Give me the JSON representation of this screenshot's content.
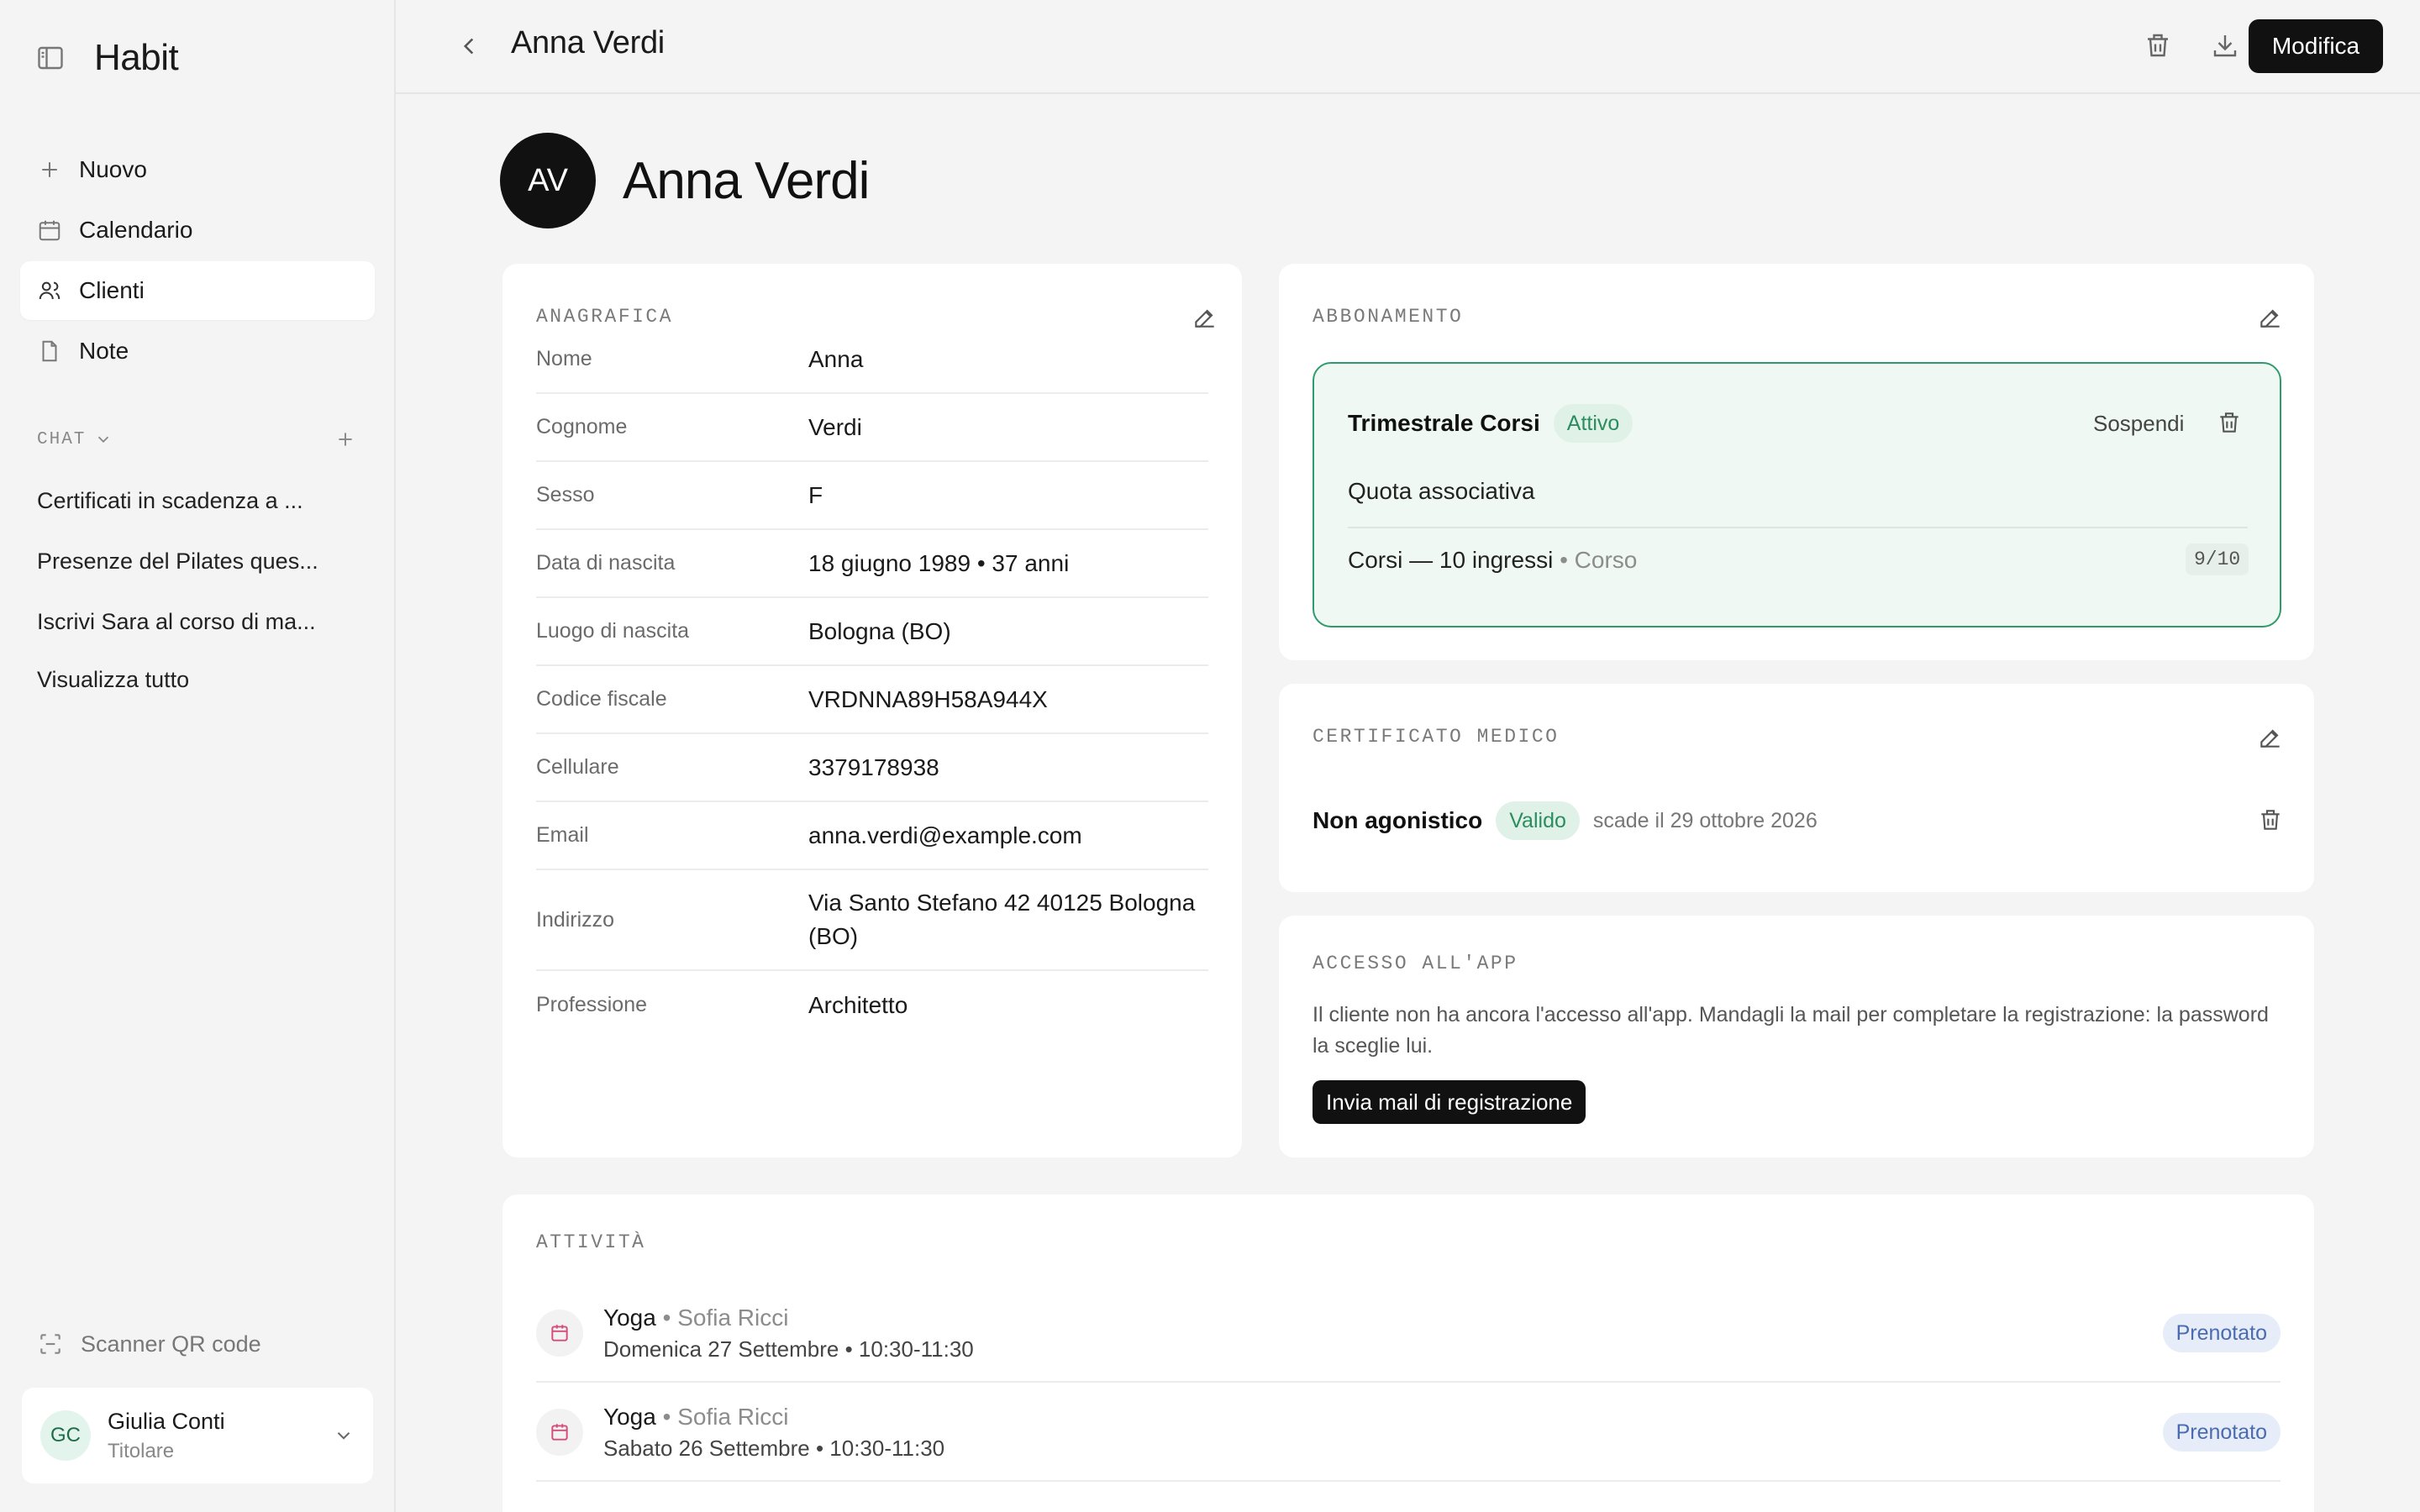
{
  "app": {
    "name": "Habit"
  },
  "sidebar": {
    "nav": [
      {
        "label": "Nuovo",
        "icon": "plus-icon"
      },
      {
        "label": "Calendario",
        "icon": "calendar-icon"
      },
      {
        "label": "Clienti",
        "icon": "users-icon",
        "active": true
      },
      {
        "label": "Note",
        "icon": "note-icon"
      }
    ],
    "chat_label": "CHAT",
    "chats": [
      "Certificati in scadenza a ...",
      "Presenze del Pilates ques...",
      "Iscrivi Sara al corso di ma...",
      "Visualizza tutto"
    ],
    "qr_label": "Scanner QR code",
    "user": {
      "initials": "GC",
      "name": "Giulia Conti",
      "role": "Titolare"
    }
  },
  "topbar": {
    "title": "Anna Verdi",
    "edit_label": "Modifica"
  },
  "profile": {
    "initials": "AV",
    "name": "Anna Verdi"
  },
  "anagrafica": {
    "title": "ANAGRAFICA",
    "rows": [
      {
        "key": "Nome",
        "value": "Anna"
      },
      {
        "key": "Cognome",
        "value": "Verdi"
      },
      {
        "key": "Sesso",
        "value": "F"
      },
      {
        "key": "Data di nascita",
        "value": "18 giugno 1989 • 37 anni"
      },
      {
        "key": "Luogo di nascita",
        "value": "Bologna (BO)"
      },
      {
        "key": "Codice fiscale",
        "value": "VRDNNA89H58A944X"
      },
      {
        "key": "Cellulare",
        "value": "3379178938"
      },
      {
        "key": "Email",
        "value": "anna.verdi@example.com"
      },
      {
        "key": "Indirizzo",
        "value": "Via Santo Stefano 42 40125 Bologna (BO)"
      },
      {
        "key": "Professione",
        "value": "Architetto"
      }
    ]
  },
  "abbonamento": {
    "title": "ABBONAMENTO",
    "plan_name": "Trimestrale Corsi",
    "status": "Attivo",
    "suspend_label": "Sospendi",
    "fee_label": "Quota associativa",
    "package": "Corsi — 10 ingressi",
    "package_type": "• Corso",
    "usage": "9/10"
  },
  "certificato": {
    "title": "CERTIFICATO MEDICO",
    "type": "Non agonistico",
    "status": "Valido",
    "expiry": "scade il 29 ottobre 2026"
  },
  "accesso": {
    "title": "ACCESSO ALL'APP",
    "message": "Il cliente non ha ancora l'accesso all'app. Mandagli la mail per completare la registrazione: la password la sceglie lui.",
    "button_label": "Invia mail di registrazione"
  },
  "attivita": {
    "title": "ATTIVITÀ",
    "items": [
      {
        "course": "Yoga",
        "instructor": "• Sofia Ricci",
        "when": "Domenica 27 Settembre • 10:30-11:30",
        "status": "Prenotato"
      },
      {
        "course": "Yoga",
        "instructor": "• Sofia Ricci",
        "when": "Sabato 26 Settembre • 10:30-11:30",
        "status": "Prenotato"
      }
    ]
  },
  "colors": {
    "accent_green": "#2f9b6c",
    "dark": "#111111",
    "booked_blue": "#4b6bb0",
    "calendar_pink": "#d44d7a"
  }
}
